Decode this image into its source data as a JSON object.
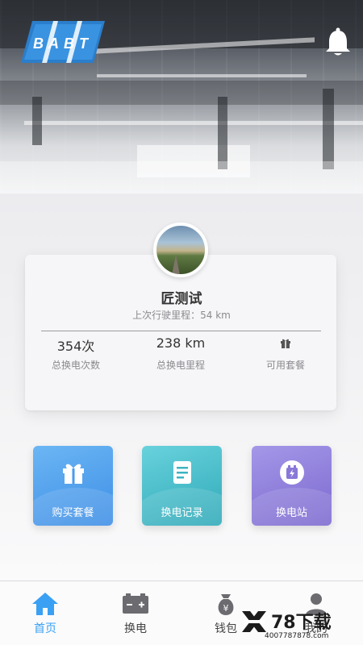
{
  "header": {
    "logo_text": "BABT",
    "bell_icon": "bell-icon"
  },
  "profile": {
    "name": "匠测试",
    "last_trip": "上次行驶里程：54 km"
  },
  "stats": [
    {
      "value": "354次",
      "label": "总换电次数"
    },
    {
      "value": "238 km",
      "label": "总换电里程"
    },
    {
      "icon": "gift-icon",
      "label": "可用套餐"
    }
  ],
  "actions": [
    {
      "label": "购买套餐",
      "icon": "gift-icon",
      "color": "#4a9cec"
    },
    {
      "label": "换电记录",
      "icon": "document-icon",
      "color": "#3db4c2"
    },
    {
      "label": "换电站",
      "icon": "battery-station-icon",
      "color": "#8a78d8"
    }
  ],
  "tabbar": [
    {
      "label": "首页",
      "icon": "home-icon",
      "active": true
    },
    {
      "label": "换电",
      "icon": "battery-icon",
      "active": false
    },
    {
      "label": "钱包",
      "icon": "wallet-icon",
      "active": false
    },
    {
      "label": "我的",
      "icon": "user-icon",
      "active": false
    }
  ],
  "watermark": {
    "title": "78下载",
    "url": "4007787878.com"
  },
  "colors": {
    "accent": "#3aa0f3",
    "tab_inactive": "#6b6b70"
  }
}
